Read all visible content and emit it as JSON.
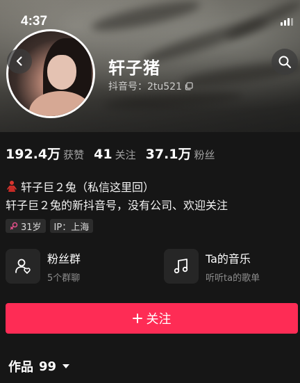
{
  "status_bar": {
    "time": "4:37"
  },
  "profile": {
    "nickname": "轩子猪",
    "douyin_id": "抖音号：2tu521",
    "bio_line1": "轩子巨２兔（私信这里回）",
    "bio_line2": "轩子巨２兔的新抖音号，没有公司、欢迎关注"
  },
  "stats": [
    {
      "value": "192.4万",
      "label": "获赞"
    },
    {
      "value": "41",
      "label": "关注"
    },
    {
      "value": "37.1万",
      "label": "粉丝"
    }
  ],
  "tags": {
    "age": "31岁",
    "ip": "IP：上海"
  },
  "cards": {
    "fans_group": {
      "title": "粉丝群",
      "subtitle": "5个群聊"
    },
    "music": {
      "title": "Ta的音乐",
      "subtitle": "听听ta的歌单"
    }
  },
  "follow_button": {
    "label": "关注"
  },
  "works_tab": {
    "label": "作品",
    "count": "99"
  },
  "colors": {
    "follow_button": "#fe2c55",
    "background": "#161616",
    "card_bg": "#262626",
    "female_icon": "#e8508c"
  },
  "icons": {
    "back": "chevron-left-icon",
    "search": "search-icon",
    "copy": "copy-icon",
    "fans_group": "people-heart-icon",
    "music": "music-note-icon",
    "female": "female-icon",
    "dropdown": "caret-down-icon",
    "plus": "plus-icon"
  }
}
